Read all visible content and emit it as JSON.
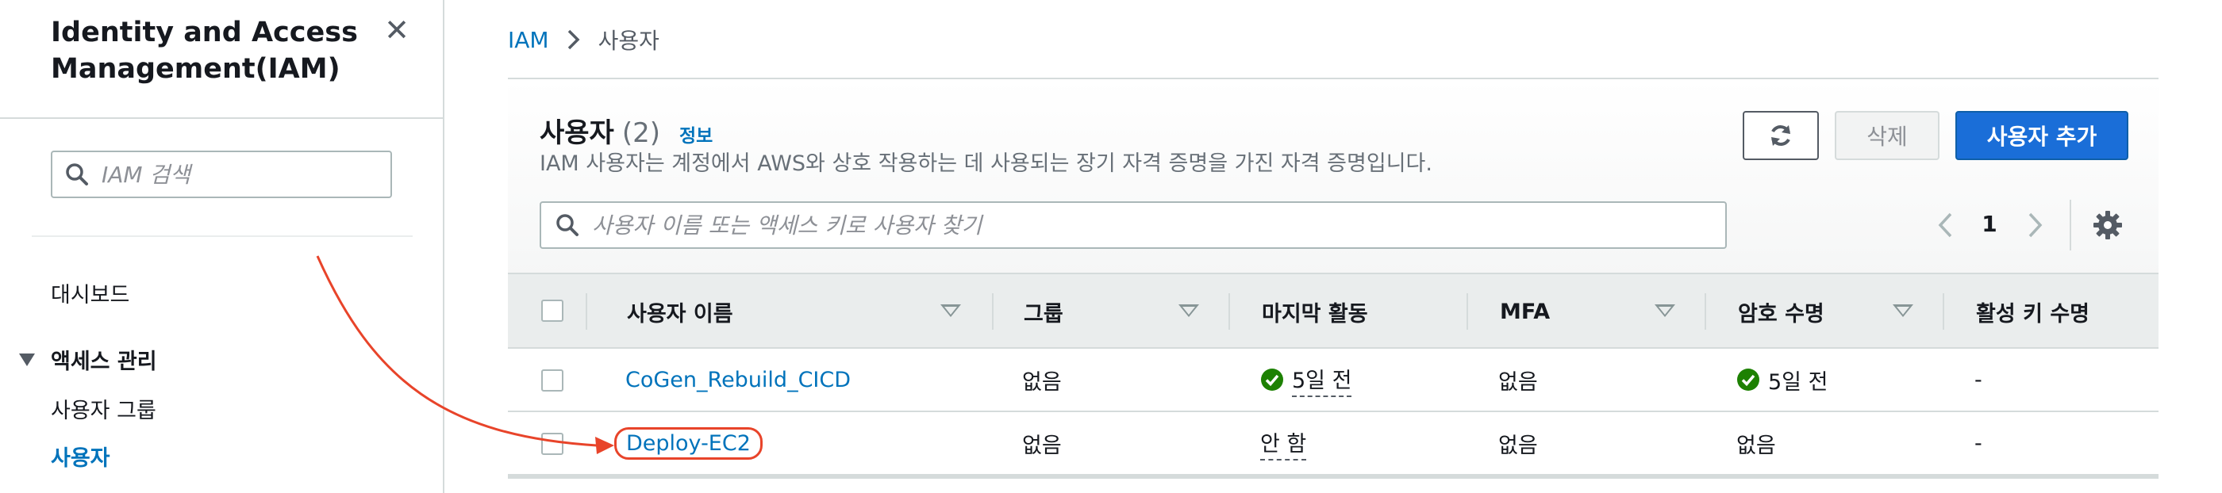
{
  "sidebar": {
    "title": "Identity and Access Management(IAM)",
    "search_placeholder": "IAM 검색",
    "dashboard": "대시보드",
    "section_access": "액세스 관리",
    "user_groups": "사용자 그룹",
    "users": "사용자"
  },
  "breadcrumb": {
    "root": "IAM",
    "current": "사용자"
  },
  "panel": {
    "title": "사용자",
    "count": "(2)",
    "info": "정보",
    "description": "IAM 사용자는 계정에서 AWS와 상호 작용하는 데 사용되는 장기 자격 증명을 가진 자격 증명입니다.",
    "delete_label": "삭제",
    "add_label": "사용자 추가",
    "search_placeholder": "사용자 이름 또는 액세스 키로 사용자 찾기",
    "page": "1"
  },
  "table": {
    "columns": [
      "사용자 이름",
      "그룹",
      "마지막 활동",
      "MFA",
      "암호 수명",
      "활성 키 수명"
    ],
    "rows": [
      {
        "name": "CoGen_Rebuild_CICD",
        "groups": "없음",
        "last_activity": "5일 전",
        "mfa": "없음",
        "password_age": "5일 전",
        "key_age": "-"
      },
      {
        "name": "Deploy-EC2",
        "groups": "없음",
        "last_activity": "안 함",
        "mfa": "없음",
        "password_age": "없음",
        "key_age": "-"
      }
    ]
  },
  "colors": {
    "link": "#0073bb",
    "primary_button": "#1a6ed8",
    "success": "#1d8102",
    "annotation": "#e8442a"
  }
}
